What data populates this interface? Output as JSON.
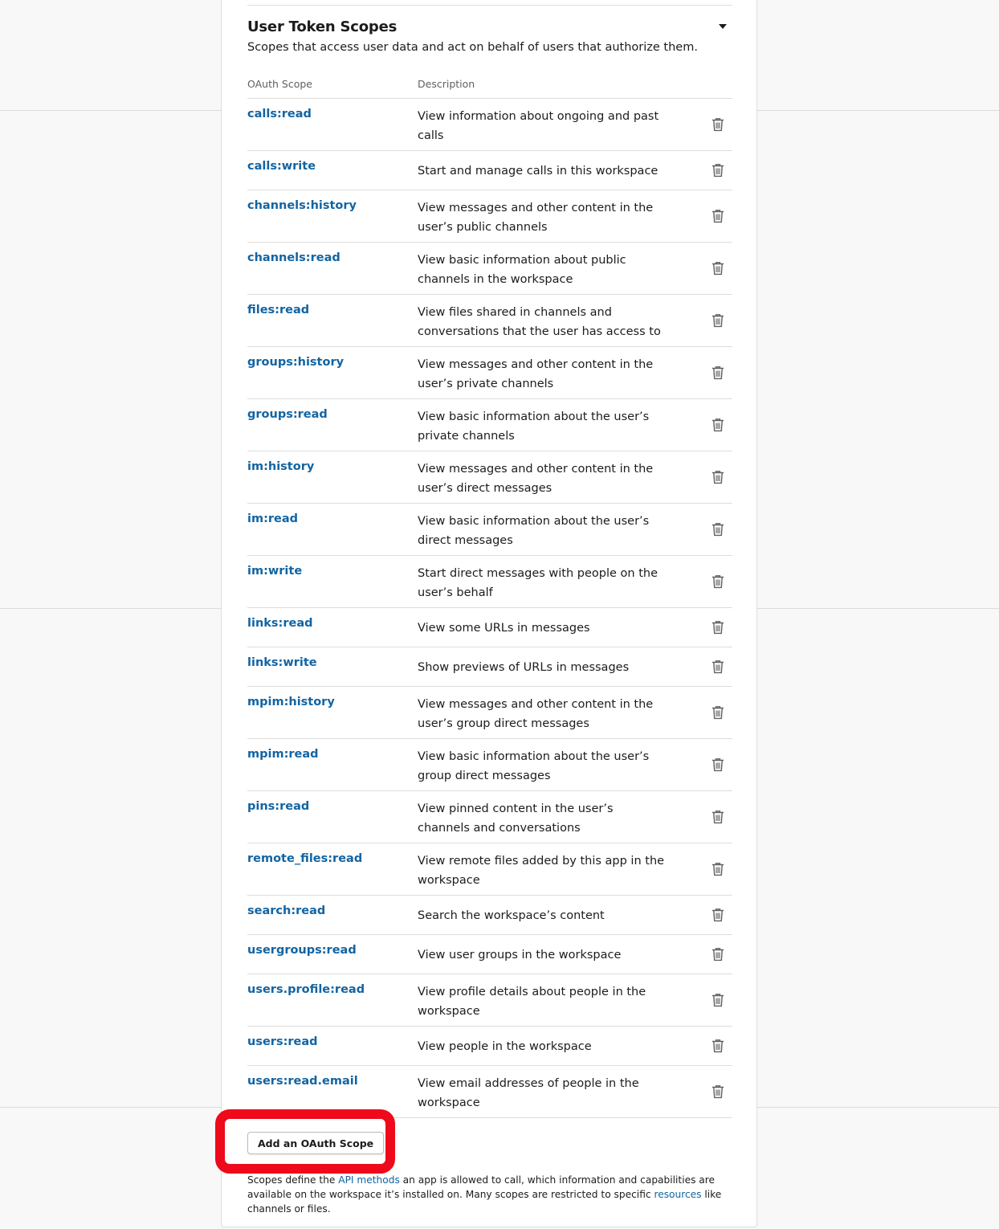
{
  "section": {
    "title": "User Token Scopes",
    "subtitle": "Scopes that access user data and act on behalf of users that authorize them."
  },
  "table": {
    "col_scope": "OAuth Scope",
    "col_description": "Description"
  },
  "scopes": [
    {
      "name": "calls:read",
      "desc": "View information about ongoing and past calls",
      "tall": true
    },
    {
      "name": "calls:write",
      "desc": "Start and manage calls in this workspace",
      "tall": false
    },
    {
      "name": "channels:history",
      "desc": "View messages and other content in the user’s public channels",
      "tall": true
    },
    {
      "name": "channels:read",
      "desc": "View basic information about public channels in the workspace",
      "tall": true
    },
    {
      "name": "files:read",
      "desc": "View files shared in channels and conversations that the user has access to",
      "tall": true
    },
    {
      "name": "groups:history",
      "desc": "View messages and other content in the user’s private channels",
      "tall": true
    },
    {
      "name": "groups:read",
      "desc": "View basic information about the user’s private channels",
      "tall": true
    },
    {
      "name": "im:history",
      "desc": "View messages and other content in the user’s direct messages",
      "tall": true
    },
    {
      "name": "im:read",
      "desc": "View basic information about the user’s direct messages",
      "tall": true
    },
    {
      "name": "im:write",
      "desc": "Start direct messages with people on the user’s behalf",
      "tall": true
    },
    {
      "name": "links:read",
      "desc": "View some URLs in messages",
      "tall": false
    },
    {
      "name": "links:write",
      "desc": "Show previews of URLs in messages",
      "tall": false
    },
    {
      "name": "mpim:history",
      "desc": "View messages and other content in the user’s group direct messages",
      "tall": true
    },
    {
      "name": "mpim:read",
      "desc": "View basic information about the user’s group direct messages",
      "tall": true
    },
    {
      "name": "pins:read",
      "desc": "View pinned content in the user’s channels and conversations",
      "tall": true
    },
    {
      "name": "remote_files:read",
      "desc": "View remote files added by this app in the workspace",
      "tall": true
    },
    {
      "name": "search:read",
      "desc": "Search the workspace’s content",
      "tall": false
    },
    {
      "name": "usergroups:read",
      "desc": "View user groups in the workspace",
      "tall": false
    },
    {
      "name": "users.profile:read",
      "desc": "View profile details about people in the workspace",
      "tall": true
    },
    {
      "name": "users:read",
      "desc": "View people in the workspace",
      "tall": false
    },
    {
      "name": "users:read.email",
      "desc": "View email addresses of people in the workspace",
      "tall": true
    }
  ],
  "add_button_label": "Add an OAuth Scope",
  "footnote": {
    "part1": "Scopes define the ",
    "link1": "API methods",
    "part2": " an app is allowed to call, which information and capabilities are available on the workspace it’s installed on. Many scopes are restricted to specific ",
    "link2": "resources",
    "part3": " like channels or files."
  },
  "icons": {
    "row_action": "trash-icon",
    "section_toggle": "caret-down-icon"
  },
  "colors": {
    "link": "#1264a3",
    "text": "#1d1c1d",
    "muted": "#616061",
    "highlight": "#ee0a1a"
  }
}
